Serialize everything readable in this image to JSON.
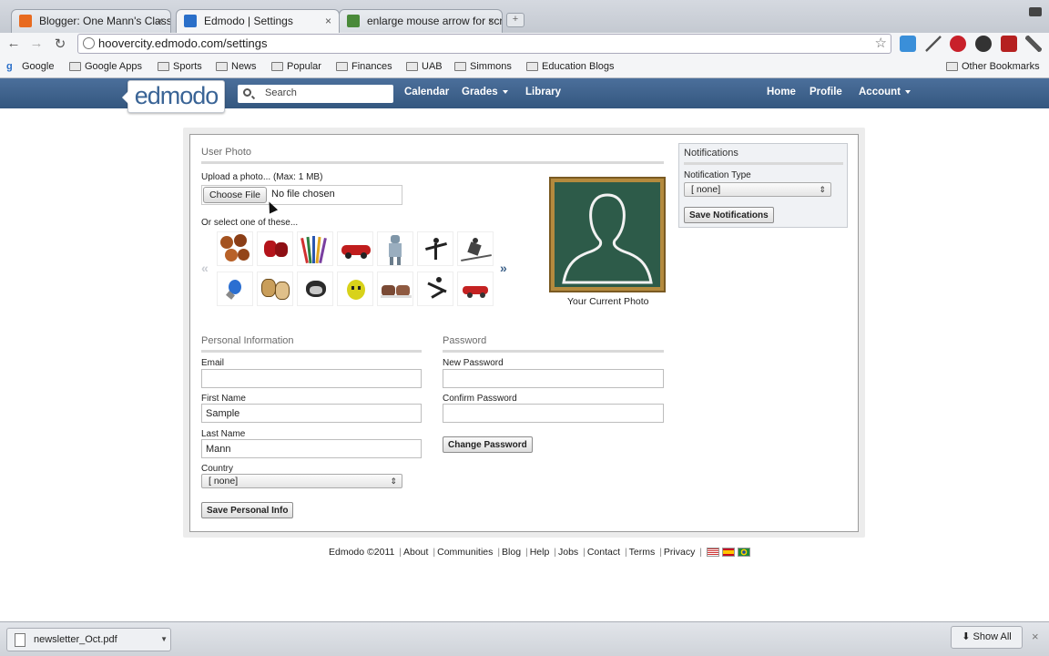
{
  "browser": {
    "tabs": [
      {
        "title": "Blogger: One Mann's Classro",
        "favicon_color": "#e86a1f",
        "active": false
      },
      {
        "title": "Edmodo | Settings",
        "favicon_color": "#2a6fc9",
        "active": true
      },
      {
        "title": "enlarge mouse arrow for scr",
        "favicon_color": "#4a8a3a",
        "active": false
      }
    ],
    "tab_close": "×",
    "new_tab": "+",
    "back": "←",
    "forward": "→",
    "reload": "↻",
    "url": "hoovercity.edmodo.com/settings",
    "star": "☆",
    "bookmarks": [
      "Google",
      "Google Apps",
      "Sports",
      "News",
      "Popular",
      "Finances",
      "UAB",
      "Simmons",
      "Education Blogs"
    ],
    "other_bookmarks": "Other Bookmarks"
  },
  "edmodo": {
    "logo": "edmodo",
    "search_placeholder": "Search",
    "nav_left": [
      "Calendar",
      "Grades",
      "Library"
    ],
    "nav_right": [
      "Home",
      "Profile",
      "Account"
    ],
    "brand_color": "#3d6189"
  },
  "user_photo": {
    "section_title": "User Photo",
    "upload_label": "Upload a photo... (Max: 1 MB)",
    "choose_file": "Choose File",
    "no_file": "No file chosen",
    "select_label": "Or select one of these...",
    "prev_arrow": "«",
    "next_arrow": "»",
    "avatars_row1": [
      "basketballs",
      "boxing-gloves",
      "colored-pencils",
      "race-car",
      "robot",
      "ballerina",
      "skier"
    ],
    "avatars_row2": [
      "lightbulb",
      "theater-masks",
      "dog",
      "smiley-face",
      "sneakers",
      "runner",
      "toy-car"
    ],
    "current_photo_label": "Your Current Photo"
  },
  "notifications": {
    "title": "Notifications",
    "type_label": "Notification Type",
    "type_value": "[ none]",
    "save_button": "Save Notifications"
  },
  "personal_info": {
    "title": "Personal Information",
    "email_label": "Email",
    "email_value": "",
    "first_name_label": "First Name",
    "first_name_value": "Sample",
    "last_name_label": "Last Name",
    "last_name_value": "Mann",
    "country_label": "Country",
    "country_value": "[ none]",
    "save_button": "Save Personal Info"
  },
  "password": {
    "title": "Password",
    "new_label": "New Password",
    "confirm_label": "Confirm Password",
    "change_button": "Change Password"
  },
  "footer": {
    "copyright": "Edmodo ©2011",
    "links": [
      "About",
      "Communities",
      "Blog",
      "Help",
      "Jobs",
      "Contact",
      "Terms",
      "Privacy"
    ]
  },
  "downloads": {
    "file": "newsletter_Oct.pdf",
    "show_all": "Show All",
    "close": "×"
  }
}
